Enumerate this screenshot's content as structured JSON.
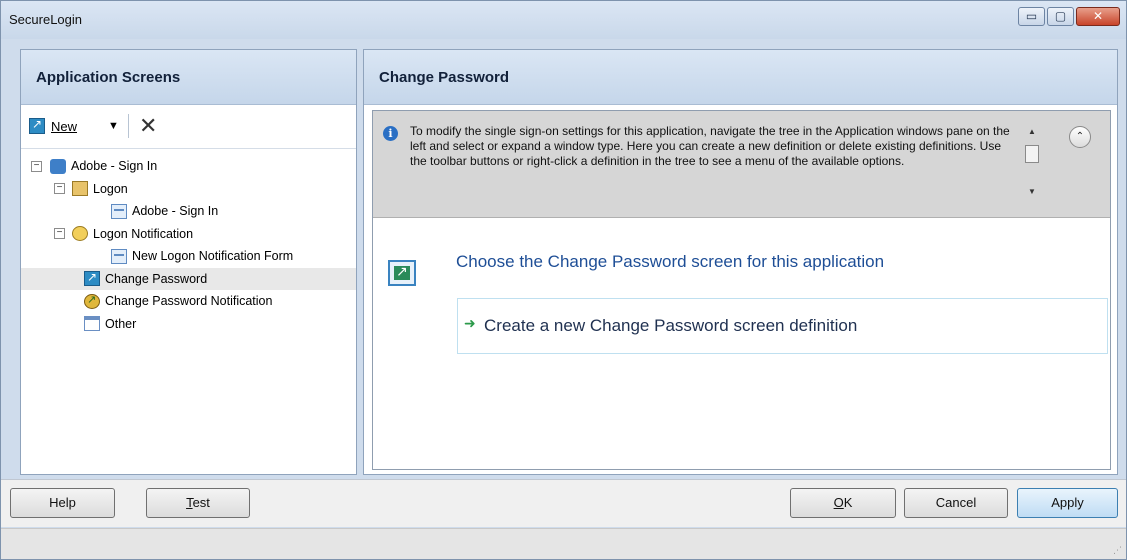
{
  "window": {
    "title": "SecureLogin",
    "min_glyph": "▭",
    "max_glyph": "▢",
    "close_glyph": "✕"
  },
  "left_pane": {
    "header": "Application Screens",
    "toolbar": {
      "new_label": "New",
      "dropdown_glyph": "▼",
      "delete_glyph": "✕"
    },
    "tree": [
      {
        "label": "Adobe - Sign In",
        "icon": "application-icon",
        "expander": "−"
      },
      {
        "label": "Logon",
        "icon": "logon-key-icon",
        "expander": "−"
      },
      {
        "label": "Adobe - Sign In",
        "icon": "form-icon"
      },
      {
        "label": "Logon Notification",
        "icon": "notification-icon",
        "expander": "−"
      },
      {
        "label": "New Logon Notification Form",
        "icon": "form-icon"
      },
      {
        "label": "Change Password",
        "icon": "change-password-icon",
        "selected": true
      },
      {
        "label": "Change Password Notification",
        "icon": "change-password-notification-icon"
      },
      {
        "label": "Other",
        "icon": "window-icon"
      }
    ]
  },
  "right_pane": {
    "header": "Change Password",
    "info_text": "To modify the single sign-on settings for this application, navigate the tree in the Application windows pane on the left and select or expand a window type. Here you can create a new definition or delete existing definitions. Use the toolbar buttons or right-click a definition in the tree to see a menu of the available options.",
    "info_glyph": "i",
    "collapse_glyph": "⌃",
    "scroll_up": "▲",
    "scroll_down": "▼",
    "choose_title": "Choose the Change Password screen for this application",
    "create_link": "Create a new Change Password screen definition",
    "create_arrow": "➜"
  },
  "buttons": {
    "help": "Help",
    "test_prefix": "",
    "test_mnemonic": "T",
    "test_rest": "est",
    "ok_mnemonic": "O",
    "ok_rest": "K",
    "cancel": "Cancel",
    "apply": "Apply"
  },
  "statusbar": {
    "grip": "⋰"
  }
}
